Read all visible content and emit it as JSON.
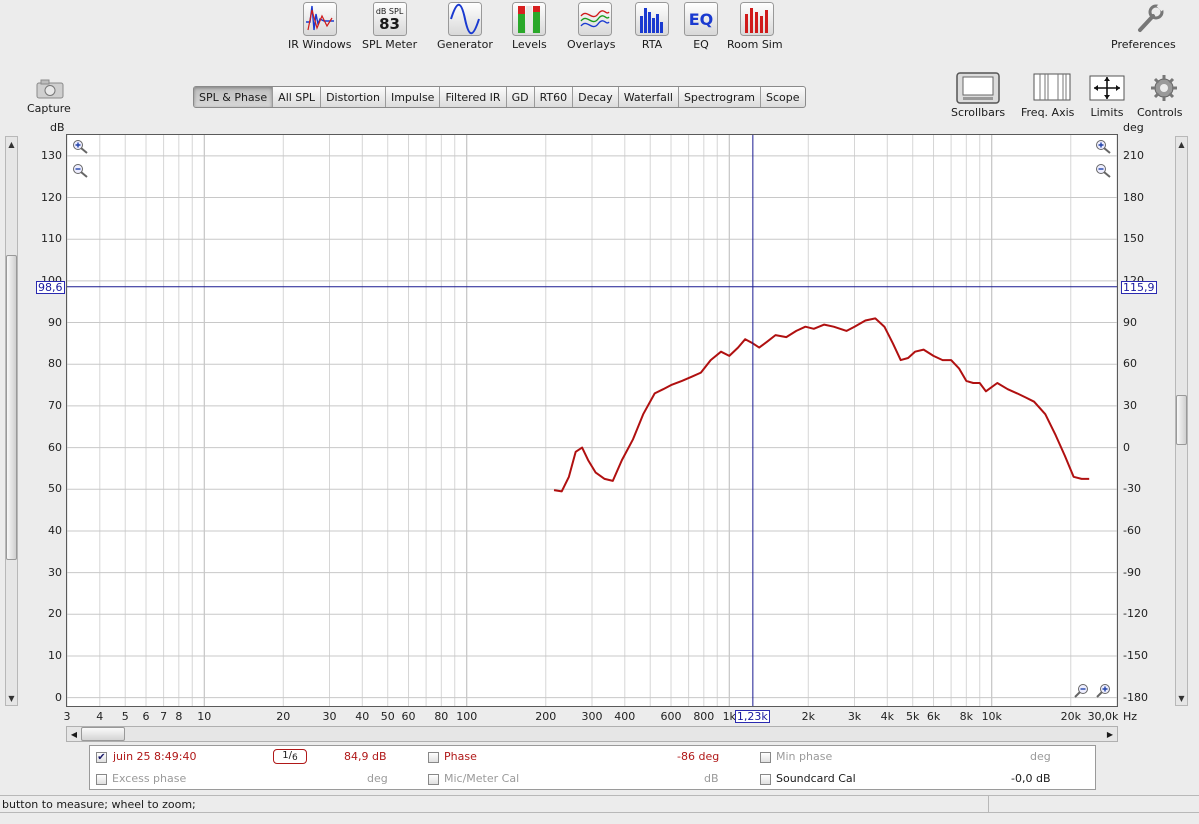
{
  "toolbar": {
    "items": [
      {
        "label": "IR Windows",
        "icon": "ir-windows-icon"
      },
      {
        "label": "SPL Meter",
        "icon": "spl-meter-icon",
        "top": "dB SPL",
        "value": "83"
      },
      {
        "label": "Generator",
        "icon": "generator-icon"
      },
      {
        "label": "Levels",
        "icon": "levels-icon"
      },
      {
        "label": "Overlays",
        "icon": "overlays-icon"
      },
      {
        "label": "RTA",
        "icon": "rta-icon"
      },
      {
        "label": "EQ",
        "icon": "eq-icon",
        "text": "EQ"
      },
      {
        "label": "Room Sim",
        "icon": "room-sim-icon"
      }
    ],
    "preferences": "Preferences"
  },
  "left": {
    "capture": "Capture"
  },
  "right_tools": [
    {
      "label": "Scrollbars",
      "icon": "scrollbars-icon"
    },
    {
      "label": "Freq. Axis",
      "icon": "freq-axis-icon"
    },
    {
      "label": "Limits",
      "icon": "limits-icon"
    },
    {
      "label": "Controls",
      "icon": "controls-icon"
    }
  ],
  "tabs": [
    "SPL & Phase",
    "All SPL",
    "Distortion",
    "Impulse",
    "Filtered IR",
    "GD",
    "RT60",
    "Decay",
    "Waterfall",
    "Spectrogram",
    "Scope"
  ],
  "active_tab": 0,
  "axes": {
    "left_unit": "dB",
    "right_unit": "deg",
    "x_unit": "Hz",
    "left_ticks": [
      "130",
      "120",
      "110",
      "100",
      "90",
      "80",
      "70",
      "60",
      "50",
      "40",
      "30",
      "20",
      "10",
      "0"
    ],
    "right_ticks": [
      "210",
      "180",
      "150",
      "120",
      "90",
      "60",
      "30",
      "0",
      "-30",
      "-60",
      "-90",
      "-120",
      "-150",
      "-180"
    ],
    "x_ticks": [
      "3",
      "4",
      "5",
      "6",
      "7",
      "8",
      "10",
      "20",
      "30",
      "40",
      "50",
      "60",
      "80",
      "100",
      "200",
      "300",
      "400",
      "600",
      "800",
      "1k",
      "2k",
      "3k",
      "4k",
      "5k",
      "6k",
      "8k",
      "10k",
      "20k",
      "30,0k"
    ]
  },
  "cursor": {
    "freq_label": "1,23k",
    "spl_label": "98,6",
    "phase_label": "115,9",
    "freq_hz": 1230,
    "spl_db": 98.6
  },
  "chart_data": {
    "type": "line",
    "title": "",
    "xlabel": "Hz",
    "ylabel": "dB",
    "xscale": "log",
    "xlim": [
      3,
      30000
    ],
    "ylim": [
      -2,
      135
    ],
    "y2label": "deg",
    "y2lim": [
      -180,
      210
    ],
    "grid": true,
    "color": "#b01010",
    "series": [
      {
        "x": [
          215,
          230,
          245,
          260,
          275,
          290,
          310,
          335,
          360,
          390,
          430,
          470,
          520,
          560,
          600,
          660,
          720,
          780,
          850,
          930,
          1000,
          1080,
          1150,
          1230,
          1300,
          1400,
          1500,
          1650,
          1800,
          1950,
          2100,
          2300,
          2500,
          2800,
          3000,
          3300,
          3600,
          3900,
          4200,
          4500,
          4800,
          5100,
          5500,
          6000,
          6500,
          7000,
          7500,
          8000,
          8500,
          9000,
          9500,
          10500,
          11500,
          12500,
          13500,
          14500,
          16000,
          17500,
          19000,
          20500,
          22000,
          23000,
          23500
        ],
        "y": [
          49.8,
          49.5,
          53,
          59,
          60,
          57,
          54,
          52.5,
          52,
          57,
          62,
          68,
          73,
          74,
          75,
          76,
          77,
          78,
          81,
          83,
          82,
          84,
          86,
          85,
          84,
          85.5,
          87,
          86.5,
          88,
          89,
          88.5,
          89.5,
          89,
          88,
          89,
          90.5,
          91,
          89,
          85,
          81,
          81.5,
          83,
          83.5,
          82,
          81,
          81,
          79,
          76,
          75.5,
          75.5,
          73.5,
          75.5,
          74,
          73,
          72,
          71,
          68,
          63,
          58,
          53,
          52.5,
          52.5,
          52.5
        ]
      }
    ]
  },
  "legend": {
    "measurement": {
      "checked": true,
      "name": "juin 25 8:49:40",
      "smoothing_num": "1",
      "smoothing_den": "6",
      "value": "84,9 dB"
    },
    "phase": {
      "checked": false,
      "label": "Phase",
      "value": "-86 deg"
    },
    "min_phase": {
      "checked": false,
      "label": "Min phase",
      "unit": "deg"
    },
    "excess_phase": {
      "checked": false,
      "label": "Excess phase",
      "unit": "deg"
    },
    "mic_cal": {
      "checked": false,
      "label": "Mic/Meter Cal",
      "unit": "dB"
    },
    "soundcard_cal": {
      "checked": false,
      "label": "Soundcard Cal",
      "value": "-0,0 dB"
    }
  },
  "status": "button to measure; wheel to zoom;"
}
